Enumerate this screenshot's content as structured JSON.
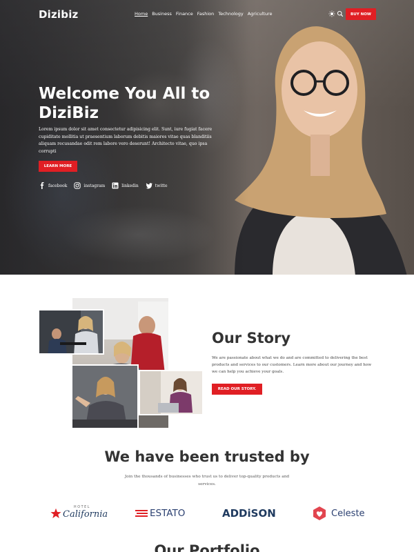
{
  "nav": {
    "logo": "Dizibiz",
    "items": [
      {
        "label": "Home",
        "active": true
      },
      {
        "label": "Business",
        "active": false
      },
      {
        "label": "Finance",
        "active": false
      },
      {
        "label": "Fashion",
        "active": false
      },
      {
        "label": "Technology",
        "active": false
      },
      {
        "label": "Agriculture",
        "active": false
      }
    ],
    "theme_icon": "sun-icon",
    "search_icon": "search-icon",
    "buy_label": "BUY NOW"
  },
  "hero": {
    "title": "Welcome You All to DiziBiz",
    "text": "Lorem ipsum dolor sit amet consectetur adipisicing elit. Sunt, iure fugiat facere cupiditate mollitia ut praesentium laborum debitis maiores vitae quas blanditiis aliquam recusandae odit rem labore vero deserunt! Architecto vitae, quo ipsa corrupti",
    "button_label": "LEARN MORE",
    "socials": [
      {
        "icon": "facebook-icon",
        "label": "facebook"
      },
      {
        "icon": "instagram-icon",
        "label": "instagram"
      },
      {
        "icon": "linkedin-icon",
        "label": "linkedin"
      },
      {
        "icon": "twitter-icon",
        "label": "twitte"
      }
    ]
  },
  "story": {
    "title": "Our Story",
    "text": "We are passionate about what we do and are committed to delivering the best products and services to our customers. Learn more about our journey and how we can help you achieve your goals.",
    "button_label": "READ OUR STORY."
  },
  "trusted": {
    "title": "We have been trusted by",
    "subtitle": "Join the thousands of businesses who trust us to deliver top-quality products and services.",
    "brands": [
      {
        "name": "California",
        "prefix": "HOTEL",
        "icon": "star-icon"
      },
      {
        "name": "ESTATO",
        "icon": "stripes-icon"
      },
      {
        "name": "ADDiSON"
      },
      {
        "name": "Celeste",
        "icon": "heart-icon"
      }
    ]
  },
  "portfolio": {
    "title": "Our Portfolio"
  },
  "colors": {
    "accent": "#e01f24",
    "addison": "#1f3a5f",
    "estato": "#2a3f70",
    "celeste": "#e2454f"
  }
}
